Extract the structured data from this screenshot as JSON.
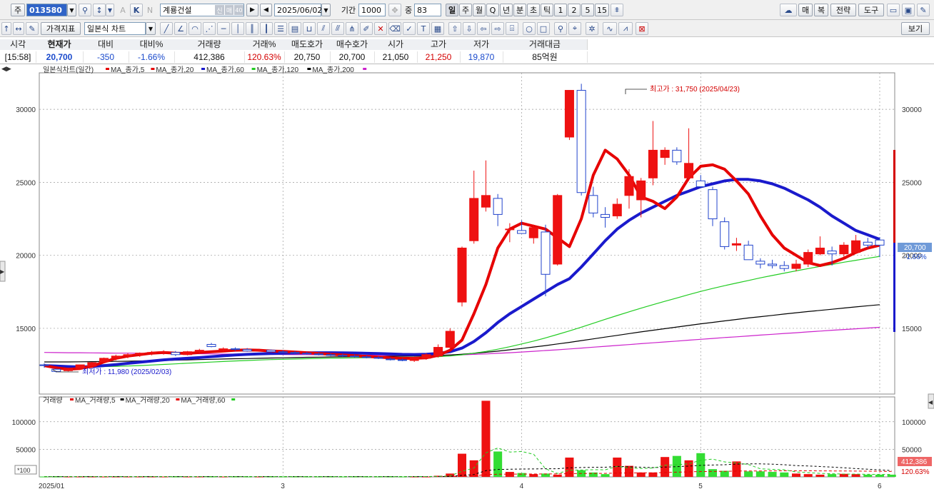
{
  "toolbar": {
    "market_label": "주",
    "stock_code": "013580",
    "stock_name": "계룡건설",
    "new_badge": "신",
    "info_badges": [
      "매",
      "40"
    ],
    "date": "2025/06/02",
    "period_label": "기간",
    "period_value": "1000",
    "count_label": "중",
    "count_value": "83",
    "timeframes": [
      "일",
      "주",
      "월",
      "Q",
      "년",
      "분",
      "초",
      "틱",
      "1",
      "2",
      "5",
      "15"
    ],
    "right_buttons": [
      "매",
      "복",
      "전략",
      "도구"
    ],
    "chart_type": "일본식 차트",
    "price_indicator": "가격지표",
    "view_button": "보기"
  },
  "price_info": {
    "headers": [
      "시각",
      "현재가",
      "대비",
      "대비%",
      "거래량",
      "거래%",
      "매도호가",
      "매수호가",
      "시가",
      "고가",
      "저가",
      "거래대금"
    ],
    "values": [
      "[15:58]",
      "20,700",
      "-350",
      "-1.66%",
      "412,386",
      "120.63%",
      "20,750",
      "20,700",
      "21,050",
      "21,250",
      "19,870",
      "85억원"
    ]
  },
  "legend": {
    "price_title": "일본식차트(일간)",
    "price_ma": [
      {
        "label": "MA_종가,5",
        "color": "#e60000"
      },
      {
        "label": "MA_종가,20",
        "color": "#e60000"
      },
      {
        "label": "MA_종가,60",
        "color": "#1a1acc"
      },
      {
        "label": "MA_종가,120",
        "color": "#22cc22"
      },
      {
        "label": "MA_종가,200",
        "color": "#000000"
      }
    ],
    "volume_title": "거래량",
    "volume_ma": [
      {
        "label": "MA_거래량,5",
        "color": "#e60000"
      },
      {
        "label": "MA_거래량,20",
        "color": "#000000"
      },
      {
        "label": "MA_거래량,60",
        "color": "#e60000"
      }
    ]
  },
  "annotations": {
    "high_label": "최고가 : 31,750 (2025/04/23)",
    "low_label": "최저가 : 11,980 (2025/02/03)",
    "current_price": "20,700",
    "change_pct": "-1.66%",
    "volume_current": "412,386",
    "volume_pct": "120.63%",
    "volume_unit": "*100"
  },
  "chart_data": [
    {
      "type": "candlestick",
      "title": "일본식차트(일간)",
      "y_ticks": [
        15000,
        20000,
        25000,
        30000
      ],
      "ylim": [
        10500,
        32500
      ],
      "x_tick_labels": [
        "2025/01",
        "3",
        "4",
        "5",
        "6"
      ],
      "high_marker": {
        "value": 31750,
        "date": "2025/04/23"
      },
      "low_marker": {
        "value": 11980,
        "date": "2025/02/03"
      },
      "candles": [
        {
          "o": 12500,
          "h": 12600,
          "l": 12300,
          "c": 12450
        },
        {
          "o": 12200,
          "h": 12250,
          "l": 11980,
          "c": 12050
        },
        {
          "o": 12100,
          "h": 12300,
          "l": 12050,
          "c": 12250
        },
        {
          "o": 12250,
          "h": 12500,
          "l": 12200,
          "c": 12500
        },
        {
          "o": 12400,
          "h": 12700,
          "l": 12300,
          "c": 12650
        },
        {
          "o": 12700,
          "h": 13000,
          "l": 12600,
          "c": 12950
        },
        {
          "o": 12950,
          "h": 13200,
          "l": 12800,
          "c": 13100
        },
        {
          "o": 13100,
          "h": 13300,
          "l": 12950,
          "c": 13200
        },
        {
          "o": 13200,
          "h": 13350,
          "l": 13050,
          "c": 13300
        },
        {
          "o": 13300,
          "h": 13450,
          "l": 13150,
          "c": 13350
        },
        {
          "o": 13350,
          "h": 13500,
          "l": 13200,
          "c": 13400
        },
        {
          "o": 13350,
          "h": 13450,
          "l": 13100,
          "c": 13200
        },
        {
          "o": 13200,
          "h": 13450,
          "l": 13150,
          "c": 13400
        },
        {
          "o": 13400,
          "h": 13600,
          "l": 13300,
          "c": 13500
        },
        {
          "o": 13900,
          "h": 14000,
          "l": 13700,
          "c": 13750
        },
        {
          "o": 13500,
          "h": 13700,
          "l": 13400,
          "c": 13600
        },
        {
          "o": 13600,
          "h": 13700,
          "l": 13450,
          "c": 13550
        },
        {
          "o": 13550,
          "h": 13650,
          "l": 13400,
          "c": 13450
        },
        {
          "o": 13450,
          "h": 13600,
          "l": 13400,
          "c": 13500
        },
        {
          "o": 13500,
          "h": 13550,
          "l": 13350,
          "c": 13400
        },
        {
          "o": 13400,
          "h": 13500,
          "l": 13300,
          "c": 13350
        },
        {
          "o": 13350,
          "h": 13450,
          "l": 13250,
          "c": 13300
        },
        {
          "o": 13300,
          "h": 13400,
          "l": 13200,
          "c": 13250
        },
        {
          "o": 13250,
          "h": 13350,
          "l": 13150,
          "c": 13200
        },
        {
          "o": 13200,
          "h": 13300,
          "l": 13100,
          "c": 13150
        },
        {
          "o": 13150,
          "h": 13250,
          "l": 13050,
          "c": 13100
        },
        {
          "o": 13100,
          "h": 13200,
          "l": 13000,
          "c": 13050
        },
        {
          "o": 13050,
          "h": 13150,
          "l": 12950,
          "c": 13000
        },
        {
          "o": 13000,
          "h": 13100,
          "l": 12900,
          "c": 12950
        },
        {
          "o": 12900,
          "h": 13000,
          "l": 12800,
          "c": 12850
        },
        {
          "o": 12850,
          "h": 12950,
          "l": 12750,
          "c": 12800
        },
        {
          "o": 12800,
          "h": 13050,
          "l": 12700,
          "c": 13000
        },
        {
          "o": 12950,
          "h": 13300,
          "l": 12850,
          "c": 13200
        },
        {
          "o": 13100,
          "h": 13900,
          "l": 13000,
          "c": 13700
        },
        {
          "o": 13700,
          "h": 15000,
          "l": 13500,
          "c": 14800
        },
        {
          "o": 16800,
          "h": 20600,
          "l": 16500,
          "c": 20500
        },
        {
          "o": 21000,
          "h": 25800,
          "l": 20800,
          "c": 23900
        },
        {
          "o": 23300,
          "h": 26500,
          "l": 23000,
          "c": 24100
        },
        {
          "o": 23900,
          "h": 24200,
          "l": 22000,
          "c": 22800
        },
        {
          "o": 21800,
          "h": 22200,
          "l": 20900,
          "c": 21800
        },
        {
          "o": 21700,
          "h": 22400,
          "l": 21500,
          "c": 21500
        },
        {
          "o": 21200,
          "h": 22100,
          "l": 20800,
          "c": 21900
        },
        {
          "o": 21600,
          "h": 22100,
          "l": 17200,
          "c": 18700
        },
        {
          "o": 19400,
          "h": 24200,
          "l": 19300,
          "c": 24100
        },
        {
          "o": 28100,
          "h": 31300,
          "l": 27900,
          "c": 31300
        },
        {
          "o": 31300,
          "h": 31750,
          "l": 24100,
          "c": 24300
        },
        {
          "o": 24100,
          "h": 24700,
          "l": 22600,
          "c": 22900
        },
        {
          "o": 22800,
          "h": 23300,
          "l": 21900,
          "c": 22600
        },
        {
          "o": 22700,
          "h": 23900,
          "l": 22500,
          "c": 23500
        },
        {
          "o": 24100,
          "h": 25900,
          "l": 23200,
          "c": 25400
        },
        {
          "o": 23800,
          "h": 25300,
          "l": 22600,
          "c": 25100
        },
        {
          "o": 25300,
          "h": 29200,
          "l": 24800,
          "c": 27200
        },
        {
          "o": 26700,
          "h": 27400,
          "l": 26200,
          "c": 27200
        },
        {
          "o": 27200,
          "h": 27400,
          "l": 26200,
          "c": 26400
        },
        {
          "o": 25300,
          "h": 28700,
          "l": 25100,
          "c": 26300
        },
        {
          "o": 25100,
          "h": 25500,
          "l": 24600,
          "c": 24700
        },
        {
          "o": 24500,
          "h": 24700,
          "l": 22000,
          "c": 22500
        },
        {
          "o": 22300,
          "h": 22600,
          "l": 20400,
          "c": 20600
        },
        {
          "o": 20700,
          "h": 21200,
          "l": 20300,
          "c": 20800
        },
        {
          "o": 20700,
          "h": 21000,
          "l": 19700,
          "c": 19700
        },
        {
          "o": 19600,
          "h": 19800,
          "l": 19100,
          "c": 19400
        },
        {
          "o": 19400,
          "h": 19700,
          "l": 19100,
          "c": 19300
        },
        {
          "o": 19300,
          "h": 19600,
          "l": 18900,
          "c": 19100
        },
        {
          "o": 19100,
          "h": 19700,
          "l": 18900,
          "c": 19400
        },
        {
          "o": 19400,
          "h": 20400,
          "l": 19200,
          "c": 20200
        },
        {
          "o": 20100,
          "h": 21300,
          "l": 20000,
          "c": 20500
        },
        {
          "o": 20300,
          "h": 20600,
          "l": 19300,
          "c": 20100
        },
        {
          "o": 20100,
          "h": 20900,
          "l": 19900,
          "c": 20700
        },
        {
          "o": 20200,
          "h": 21400,
          "l": 20100,
          "c": 21000
        },
        {
          "o": 20900,
          "h": 21200,
          "l": 20500,
          "c": 20700
        },
        {
          "o": 21050,
          "h": 21250,
          "l": 19870,
          "c": 20700
        }
      ],
      "ma5": [
        12450,
        12300,
        12200,
        12250,
        12400,
        12700,
        12950,
        13100,
        13200,
        13300,
        13350,
        13300,
        13280,
        13350,
        13400,
        13450,
        13500,
        13520,
        13500,
        13450,
        13420,
        13380,
        13330,
        13280,
        13230,
        13180,
        13130,
        13080,
        13030,
        12980,
        12940,
        12950,
        12980,
        13150,
        13500,
        14200,
        16000,
        18000,
        20500,
        21800,
        22200,
        22000,
        21800,
        21200,
        20600,
        22500,
        25500,
        27200,
        26600,
        25500,
        24000,
        23700,
        23200,
        24000,
        25300,
        26100,
        26200,
        25900,
        25100,
        24200,
        22700,
        21400,
        20500,
        20000,
        19500,
        19300,
        19500,
        19800,
        20200,
        20500,
        20700
      ],
      "ma20": [
        12450,
        12420,
        12380,
        12360,
        12380,
        12450,
        12520,
        12600,
        12680,
        12760,
        12840,
        12900,
        12950,
        13000,
        13060,
        13120,
        13180,
        13220,
        13250,
        13270,
        13290,
        13310,
        13320,
        13330,
        13330,
        13320,
        13310,
        13290,
        13270,
        13250,
        13220,
        13210,
        13230,
        13280,
        13400,
        13650,
        14100,
        14700,
        15400,
        16000,
        16500,
        17000,
        17500,
        18000,
        18400,
        19200,
        20100,
        21000,
        21800,
        22400,
        22900,
        23300,
        23700,
        24100,
        24400,
        24700,
        24900,
        25100,
        25200,
        25200,
        25100,
        24900,
        24600,
        24200,
        23800,
        23300,
        22700,
        22200,
        21700,
        21400,
        21100
      ],
      "ma60": [
        12400,
        12390,
        12380,
        12370,
        12370,
        12380,
        12400,
        12420,
        12450,
        12490,
        12530,
        12570,
        12610,
        12650,
        12690,
        12730,
        12770,
        12800,
        12830,
        12860,
        12880,
        12900,
        12920,
        12940,
        12960,
        12970,
        12980,
        12990,
        13000,
        13010,
        13010,
        13020,
        13030,
        13060,
        13110,
        13190,
        13300,
        13420,
        13570,
        13740,
        13930,
        14130,
        14350,
        14580,
        14820,
        15080,
        15350,
        15620,
        15880,
        16130,
        16380,
        16620,
        16850,
        17080,
        17310,
        17530,
        17730,
        17920,
        18100,
        18280,
        18460,
        18620,
        18780,
        18940,
        19090,
        19240,
        19380,
        19530,
        19660,
        19800,
        19930
      ],
      "ma120": [
        12700,
        12700,
        12700,
        12710,
        12720,
        12730,
        12740,
        12750,
        12770,
        12790,
        12800,
        12820,
        12840,
        12860,
        12880,
        12900,
        12920,
        12930,
        12950,
        12970,
        12980,
        13000,
        13020,
        13030,
        13040,
        13050,
        13060,
        13070,
        13080,
        13090,
        13090,
        13100,
        13110,
        13140,
        13180,
        13230,
        13290,
        13360,
        13440,
        13530,
        13620,
        13720,
        13820,
        13930,
        14040,
        14160,
        14280,
        14400,
        14520,
        14640,
        14760,
        14870,
        14980,
        15090,
        15200,
        15310,
        15410,
        15510,
        15610,
        15710,
        15800,
        15890,
        15980,
        16070,
        16150,
        16230,
        16310,
        16390,
        16470,
        16550,
        16620
      ],
      "ma200": [
        13350,
        13340,
        13330,
        13330,
        13320,
        13310,
        13300,
        13300,
        13290,
        13280,
        13280,
        13270,
        13260,
        13260,
        13250,
        13240,
        13240,
        13230,
        13220,
        13220,
        13210,
        13200,
        13200,
        13190,
        13180,
        13180,
        13170,
        13160,
        13160,
        13150,
        13150,
        13140,
        13140,
        13150,
        13170,
        13190,
        13220,
        13250,
        13290,
        13330,
        13380,
        13430,
        13480,
        13530,
        13590,
        13650,
        13710,
        13770,
        13830,
        13890,
        13950,
        14010,
        14070,
        14130,
        14190,
        14250,
        14310,
        14370,
        14420,
        14480,
        14540,
        14590,
        14650,
        14700,
        14760,
        14810,
        14870,
        14920,
        14970,
        15020,
        15070
      ]
    },
    {
      "type": "bar",
      "title": "거래량",
      "unit": "*100",
      "y_ticks": [
        50000,
        100000
      ],
      "ylim": [
        0,
        145000
      ],
      "volumes": [
        500,
        500,
        500,
        500,
        500,
        500,
        500,
        500,
        500,
        500,
        500,
        500,
        500,
        500,
        500,
        500,
        500,
        500,
        500,
        500,
        500,
        500,
        500,
        500,
        500,
        500,
        500,
        500,
        500,
        500,
        500,
        500,
        500,
        2000,
        6000,
        42000,
        30000,
        138000,
        46000,
        9000,
        7000,
        5000,
        6000,
        4000,
        35000,
        12000,
        8000,
        5000,
        35000,
        20000,
        8000,
        8000,
        36000,
        38000,
        30000,
        43000,
        14000,
        11000,
        28000,
        10000,
        10000,
        9000,
        8000,
        6000,
        5000,
        4000,
        5000,
        5500,
        5000,
        4000,
        4000,
        4000
      ],
      "ma5": [
        500,
        500,
        500,
        500,
        500,
        500,
        500,
        500,
        500,
        500,
        500,
        500,
        500,
        500,
        500,
        500,
        500,
        500,
        500,
        500,
        500,
        500,
        500,
        500,
        500,
        500,
        500,
        500,
        500,
        500,
        500,
        500,
        600,
        900,
        1800,
        10100,
        16000,
        43600,
        52400,
        45000,
        46000,
        41000,
        14600,
        6200,
        12000,
        12400,
        13000,
        12800,
        19000,
        16000,
        15200,
        16000,
        21000,
        22000,
        24000,
        30000,
        32200,
        27200,
        25200,
        22400,
        14600,
        13600,
        13000,
        8800,
        7600,
        6400,
        5700,
        5100,
        5000,
        4700,
        4400,
        4300
      ],
      "ma20": [
        500,
        500,
        500,
        500,
        500,
        500,
        500,
        500,
        500,
        500,
        500,
        500,
        500,
        500,
        500,
        500,
        500,
        500,
        500,
        500,
        500,
        500,
        500,
        500,
        500,
        500,
        500,
        500,
        500,
        500,
        500,
        500,
        500,
        600,
        800,
        2800,
        4300,
        11200,
        13500,
        13900,
        14200,
        14400,
        14700,
        14800,
        16500,
        17000,
        17300,
        17500,
        19000,
        18200,
        17500,
        16800,
        17800,
        18500,
        19500,
        20900,
        21500,
        22000,
        23200,
        23500,
        23600,
        23000,
        22000,
        20500,
        19800,
        18800,
        17800,
        16500,
        15000,
        13800,
        12600,
        11500
      ],
      "ma60": [
        500,
        500,
        500,
        500,
        500,
        500,
        500,
        500,
        500,
        500,
        500,
        500,
        500,
        500,
        500,
        500,
        500,
        500,
        500,
        500,
        500,
        500,
        500,
        500,
        500,
        500,
        500,
        500,
        500,
        500,
        500,
        500,
        500,
        550,
        650,
        1300,
        1800,
        4100,
        4800,
        5000,
        5100,
        5200,
        5300,
        5400,
        5900,
        6100,
        6200,
        6300,
        6800,
        7100,
        7200,
        7300,
        7900,
        8500,
        9000,
        9700,
        9900,
        10100,
        10500,
        10700,
        10800,
        10900,
        11000,
        11000,
        11000,
        10900,
        10800,
        10700,
        10500,
        10300,
        10100,
        9900
      ]
    }
  ]
}
